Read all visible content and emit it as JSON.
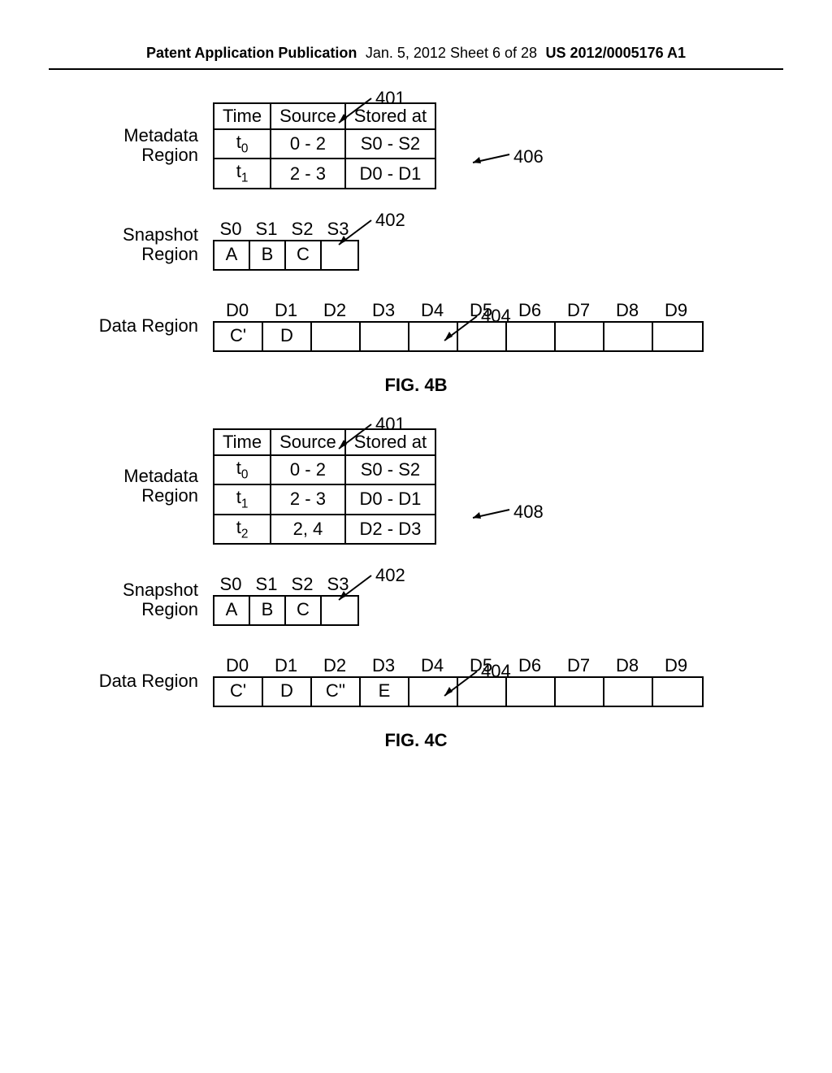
{
  "header": {
    "left": "Patent Application Publication",
    "mid": "Jan. 5, 2012   Sheet 6 of 28",
    "right": "US 2012/0005176 A1"
  },
  "fig4b": {
    "callouts": {
      "c401": "401",
      "c402": "402",
      "c404": "404",
      "c406": "406"
    },
    "metadata": {
      "label": "Metadata Region",
      "headers": [
        "Time",
        "Source",
        "Stored at"
      ],
      "rows": [
        {
          "time_base": "t",
          "time_sub": "0",
          "source": "0 - 2",
          "stored": "S0 - S2"
        },
        {
          "time_base": "t",
          "time_sub": "1",
          "source": "2 - 3",
          "stored": "D0 - D1"
        }
      ]
    },
    "snapshot": {
      "label": "Snapshot Region",
      "headers": [
        "S0",
        "S1",
        "S2",
        "S3"
      ],
      "cells": [
        "A",
        "B",
        "C",
        ""
      ]
    },
    "data": {
      "label": "Data Region",
      "headers": [
        "D0",
        "D1",
        "D2",
        "D3",
        "D4",
        "D5",
        "D6",
        "D7",
        "D8",
        "D9"
      ],
      "cells": [
        "C'",
        "D",
        "",
        "",
        "",
        "",
        "",
        "",
        "",
        ""
      ]
    },
    "figlabel": "FIG. 4B"
  },
  "fig4c": {
    "callouts": {
      "c401": "401",
      "c402": "402",
      "c404": "404",
      "c408": "408"
    },
    "metadata": {
      "label": "Metadata Region",
      "headers": [
        "Time",
        "Source",
        "Stored at"
      ],
      "rows": [
        {
          "time_base": "t",
          "time_sub": "0",
          "source": "0 - 2",
          "stored": "S0 - S2"
        },
        {
          "time_base": "t",
          "time_sub": "1",
          "source": "2 - 3",
          "stored": "D0 - D1"
        },
        {
          "time_base": "t",
          "time_sub": "2",
          "source": "2, 4",
          "stored": "D2 - D3"
        }
      ]
    },
    "snapshot": {
      "label": "Snapshot Region",
      "headers": [
        "S0",
        "S1",
        "S2",
        "S3"
      ],
      "cells": [
        "A",
        "B",
        "C",
        ""
      ]
    },
    "data": {
      "label": "Data Region",
      "headers": [
        "D0",
        "D1",
        "D2",
        "D3",
        "D4",
        "D5",
        "D6",
        "D7",
        "D8",
        "D9"
      ],
      "cells": [
        "C'",
        "D",
        "C''",
        "E",
        "",
        "",
        "",
        "",
        "",
        ""
      ]
    },
    "figlabel": "FIG. 4C"
  }
}
